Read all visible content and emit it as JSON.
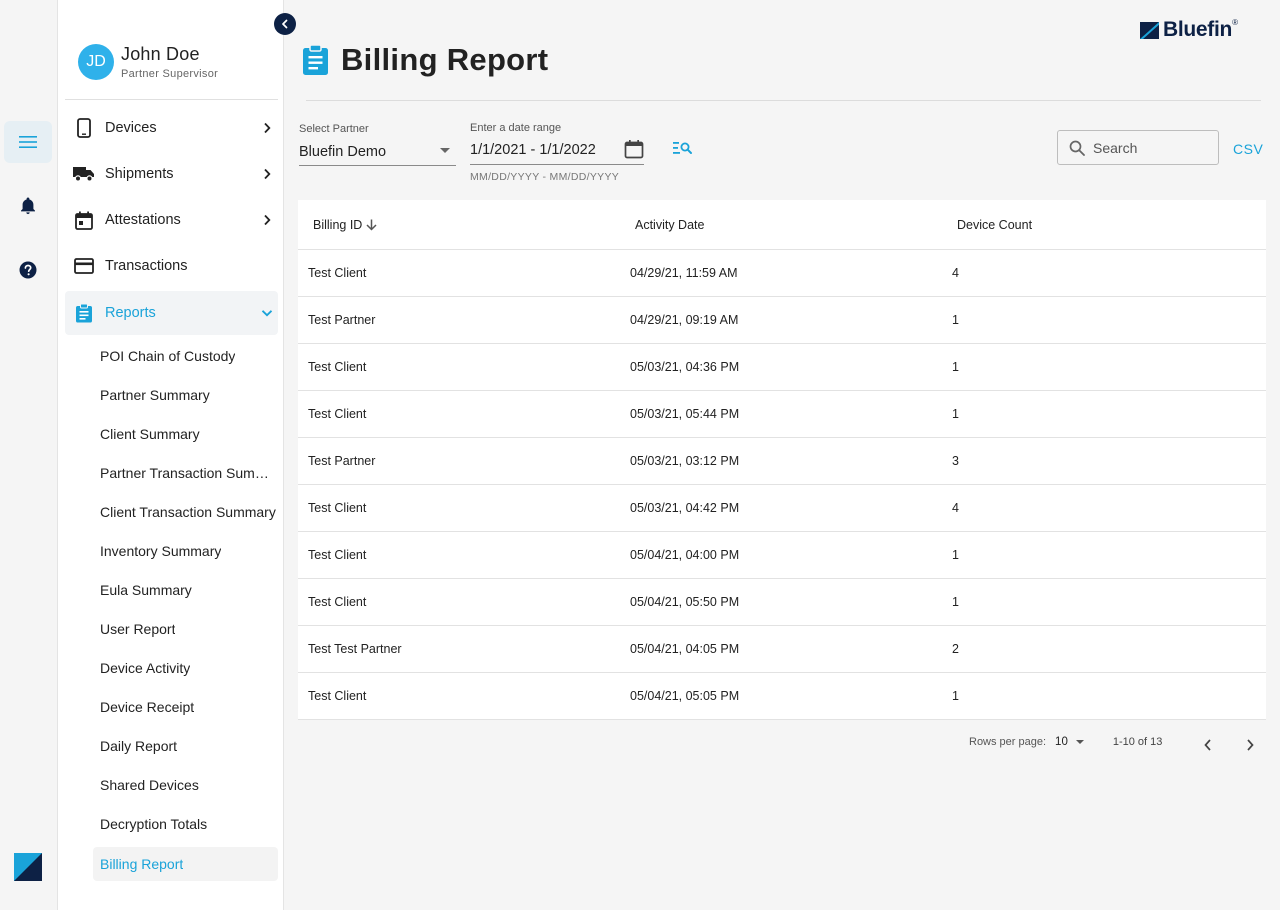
{
  "user": {
    "initials": "JD",
    "name": "John Doe",
    "role": "Partner Supervisor"
  },
  "nav": {
    "items": [
      {
        "label": "Devices",
        "icon": "phone-icon",
        "chevron": "chevron-right-icon"
      },
      {
        "label": "Shipments",
        "icon": "truck-icon",
        "chevron": "chevron-right-icon"
      },
      {
        "label": "Attestations",
        "icon": "calendar-icon",
        "chevron": "chevron-right-icon"
      },
      {
        "label": "Transactions",
        "icon": "credit-card-icon"
      },
      {
        "label": "Reports",
        "icon": "clipboard-icon",
        "chevron": "chevron-down-icon"
      }
    ],
    "sub_items": [
      "POI Chain of Custody",
      "Partner Summary",
      "Client Summary",
      "Partner Transaction Summary",
      "Client Transaction Summary",
      "Inventory Summary",
      "Eula Summary",
      "User Report",
      "Device Activity",
      "Device Receipt",
      "Daily Report",
      "Shared Devices",
      "Decryption Totals",
      "Billing Report"
    ]
  },
  "brand": {
    "name": "Bluefin",
    "reg": "®"
  },
  "page": {
    "title": "Billing Report"
  },
  "filters": {
    "partner_label": "Select Partner",
    "partner_value": "Bluefin Demo",
    "date_label": "Enter a date range",
    "date_value": "1/1/2021 - 1/1/2022",
    "date_hint": "MM/DD/YYYY - MM/DD/YYYY",
    "search_placeholder": "Search",
    "csv_label": "CSV"
  },
  "table": {
    "headers": [
      "Billing ID",
      "Activity Date",
      "Device Count"
    ],
    "rows": [
      [
        "Test Client",
        "04/29/21, 11:59 AM",
        "4"
      ],
      [
        "Test Partner",
        "04/29/21, 09:19 AM",
        "1"
      ],
      [
        "Test Client",
        "05/03/21, 04:36 PM",
        "1"
      ],
      [
        "Test Client",
        "05/03/21, 05:44 PM",
        "1"
      ],
      [
        "Test Partner",
        "05/03/21, 03:12 PM",
        "3"
      ],
      [
        "Test Client",
        "05/03/21, 04:42 PM",
        "4"
      ],
      [
        "Test Client",
        "05/04/21, 04:00 PM",
        "1"
      ],
      [
        "Test Client",
        "05/04/21, 05:50 PM",
        "1"
      ],
      [
        "Test Test Partner",
        "05/04/21, 04:05 PM",
        "2"
      ],
      [
        "Test Client",
        "05/04/21, 05:05 PM",
        "1"
      ]
    ]
  },
  "pagination": {
    "rows_per_page_label": "Rows per page:",
    "rows_per_page": "10",
    "range": "1-10 of 13"
  },
  "colors": {
    "accent": "#1aa3d9",
    "navy": "#0d2145",
    "avatar": "#2fb1ea"
  }
}
